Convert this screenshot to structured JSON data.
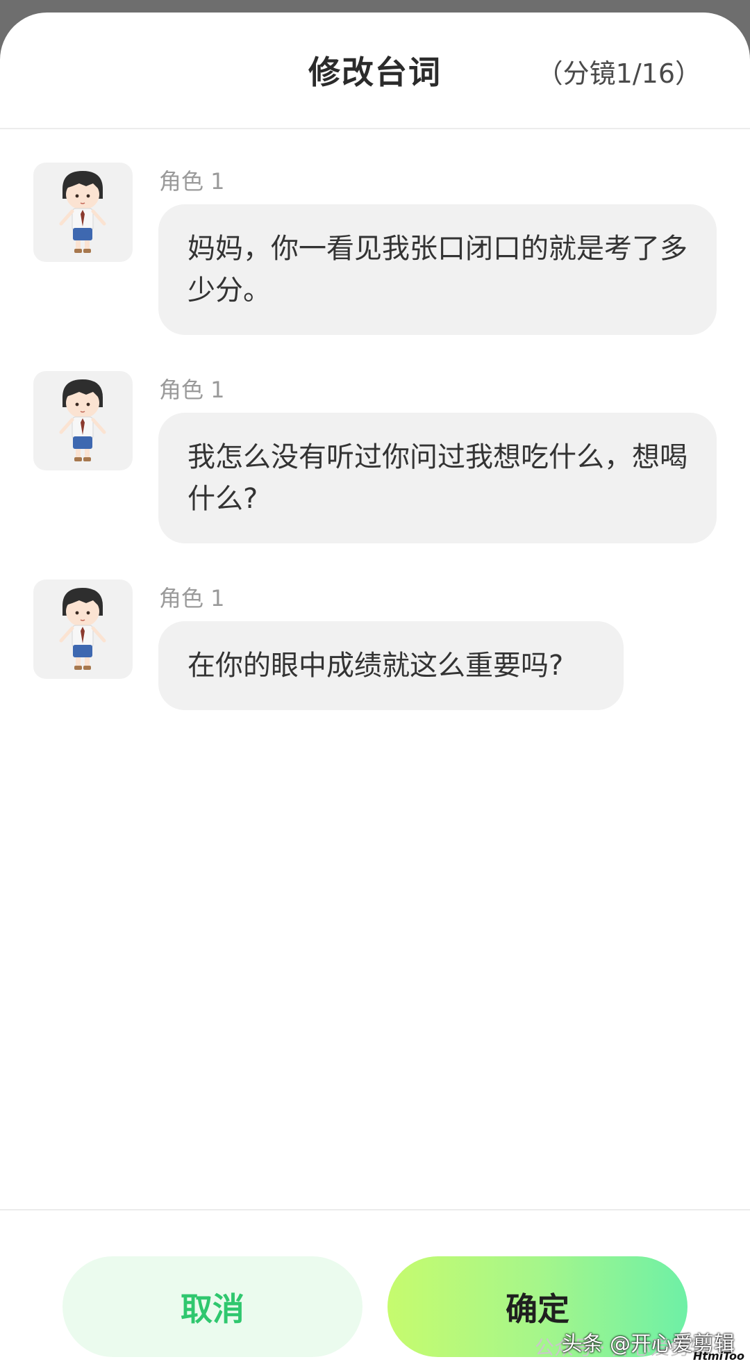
{
  "header": {
    "title": "修改台词",
    "scene_counter": "（分镜1/16）"
  },
  "messages": [
    {
      "role": "角色 1",
      "text": "妈妈，你一看见我张口闭口的就是考了多少分。",
      "avatar_icon": "boy-character-avatar-icon"
    },
    {
      "role": "角色 1",
      "text": "我怎么没有听过你问过我想吃什么，想喝什么?",
      "avatar_icon": "boy-character-avatar-icon"
    },
    {
      "role": "角色 1",
      "text": "在你的眼中成绩就这么重要吗?",
      "avatar_icon": "boy-character-avatar-icon"
    }
  ],
  "footer": {
    "cancel_label": "取消",
    "confirm_label": "确定"
  },
  "watermark": {
    "faint_text": "公众号 · 开心爱剪辑",
    "text": "头条 @开心爱剪辑",
    "logo": "HtmiToo"
  },
  "colors": {
    "accent_green": "#2fc76e",
    "bubble_bg": "#f1f1f1",
    "confirm_gradient_start": "#c6fb6e",
    "confirm_gradient_end": "#6ef0a6"
  }
}
